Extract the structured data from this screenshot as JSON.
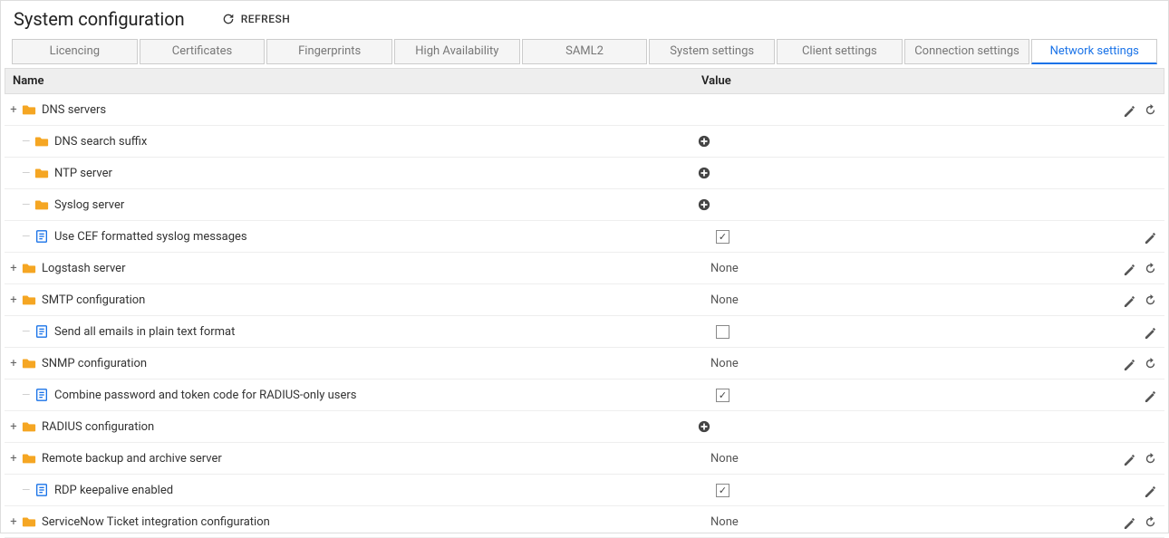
{
  "header": {
    "title": "System configuration",
    "refresh_label": "REFRESH"
  },
  "tabs": [
    {
      "label": "Licencing",
      "active": false
    },
    {
      "label": "Certificates",
      "active": false
    },
    {
      "label": "Fingerprints",
      "active": false
    },
    {
      "label": "High Availability",
      "active": false
    },
    {
      "label": "SAML2",
      "active": false
    },
    {
      "label": "System settings",
      "active": false
    },
    {
      "label": "Client settings",
      "active": false
    },
    {
      "label": "Connection settings",
      "active": false
    },
    {
      "label": "Network settings",
      "active": true
    }
  ],
  "columns": {
    "name": "Name",
    "value": "Value"
  },
  "rows": [
    {
      "depth": 0,
      "expander": "+",
      "icon": "folder",
      "label": "DNS servers",
      "value_type": "none",
      "value": "",
      "actions": [
        "edit",
        "reset"
      ]
    },
    {
      "depth": 1,
      "expander": "",
      "icon": "folder",
      "label": "DNS search suffix",
      "value_type": "add",
      "value": "",
      "actions": []
    },
    {
      "depth": 1,
      "expander": "",
      "icon": "folder",
      "label": "NTP server",
      "value_type": "add",
      "value": "",
      "actions": []
    },
    {
      "depth": 1,
      "expander": "",
      "icon": "folder",
      "label": "Syslog server",
      "value_type": "add",
      "value": "",
      "actions": []
    },
    {
      "depth": 1,
      "expander": "",
      "icon": "file",
      "label": "Use CEF formatted syslog messages",
      "value_type": "checkbox",
      "value": "checked",
      "actions": [
        "edit"
      ]
    },
    {
      "depth": 0,
      "expander": "+",
      "icon": "folder",
      "label": "Logstash server",
      "value_type": "text",
      "value": "None",
      "actions": [
        "edit",
        "reset"
      ]
    },
    {
      "depth": 0,
      "expander": "+",
      "icon": "folder",
      "label": "SMTP configuration",
      "value_type": "text",
      "value": "None",
      "actions": [
        "edit",
        "reset"
      ]
    },
    {
      "depth": 1,
      "expander": "",
      "icon": "file",
      "label": "Send all emails in plain text format",
      "value_type": "checkbox",
      "value": "",
      "actions": [
        "edit"
      ]
    },
    {
      "depth": 0,
      "expander": "+",
      "icon": "folder",
      "label": "SNMP configuration",
      "value_type": "text",
      "value": "None",
      "actions": [
        "edit",
        "reset"
      ]
    },
    {
      "depth": 1,
      "expander": "",
      "icon": "file",
      "label": "Combine password and token code for RADIUS-only users",
      "value_type": "checkbox",
      "value": "checked",
      "actions": [
        "edit"
      ]
    },
    {
      "depth": 0,
      "expander": "+",
      "icon": "folder",
      "label": "RADIUS configuration",
      "value_type": "add",
      "value": "",
      "actions": []
    },
    {
      "depth": 0,
      "expander": "+",
      "icon": "folder",
      "label": "Remote backup and archive server",
      "value_type": "text",
      "value": "None",
      "actions": [
        "edit",
        "reset"
      ]
    },
    {
      "depth": 1,
      "expander": "",
      "icon": "file",
      "label": "RDP keepalive enabled",
      "value_type": "checkbox",
      "value": "checked",
      "actions": [
        "edit"
      ]
    },
    {
      "depth": 0,
      "expander": "+",
      "icon": "folder",
      "label": "ServiceNow Ticket integration configuration",
      "value_type": "text",
      "value": "None",
      "actions": [
        "edit",
        "reset"
      ]
    }
  ]
}
